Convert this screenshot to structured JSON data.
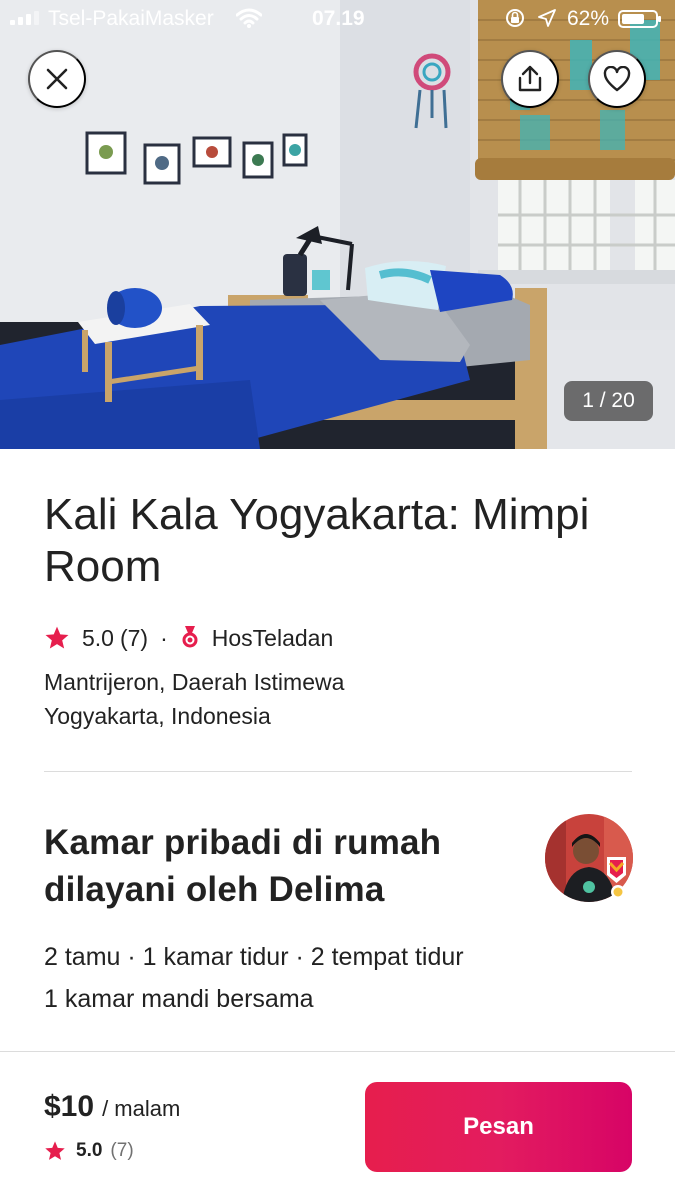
{
  "status_bar": {
    "carrier": "Tsel-PakaiMasker",
    "time": "07.19",
    "battery": "62%"
  },
  "gallery": {
    "counter": "1 / 20"
  },
  "listing": {
    "title": "Kali Kala Yogyakarta: Mimpi Room",
    "rating": "5.0",
    "review_count": "(7)",
    "separator": "·",
    "host_badge": "HosTeladan",
    "location": "Mantrijeron, Daerah Istimewa Yogyakarta, Indonesia"
  },
  "summary": {
    "heading": "Kamar pribadi di rumah dilayani oleh Delima",
    "details_line1": "2 tamu · 1 kamar tidur · 2 tempat tidur",
    "details_line2": "1 kamar mandi bersama"
  },
  "booking": {
    "price": "$10",
    "unit": "/ malam",
    "rating": "5.0",
    "review_count": "(7)",
    "button": "Pesan"
  },
  "colors": {
    "brand": "#E61E4D",
    "star": "#E61E4D",
    "text": "#222222",
    "muted": "#717171"
  },
  "icons": [
    "close-icon",
    "share-icon",
    "heart-icon",
    "star-icon",
    "medal-icon",
    "signal-icon",
    "wifi-icon",
    "lock-rotation-icon",
    "location-arrow-icon",
    "battery-icon"
  ]
}
